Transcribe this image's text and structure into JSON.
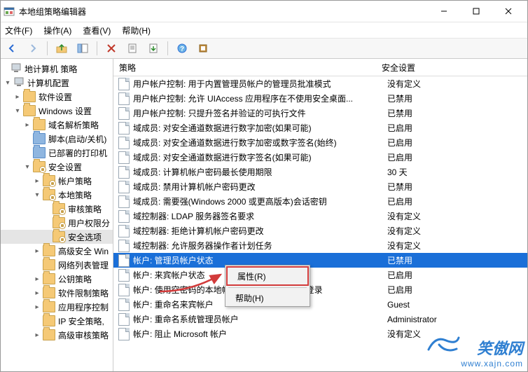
{
  "window": {
    "title": "本地组策略编辑器"
  },
  "menu": {
    "file": "文件(F)",
    "action": "操作(A)",
    "view": "查看(V)",
    "help": "帮助(H)"
  },
  "columns": {
    "policy": "策略",
    "setting": "安全设置"
  },
  "tree": {
    "root": "地计算机 策略",
    "computer_config": "计算机配置",
    "software_settings": "软件设置",
    "windows_settings": "Windows 设置",
    "name_resolution": "域名解析策略",
    "scripts": "脚本(启动/关机)",
    "deployed_printers": "已部署的打印机",
    "security_settings": "安全设置",
    "account_policies": "帐户策略",
    "local_policies": "本地策略",
    "audit_policy": "审核策略",
    "user_rights": "用户权限分",
    "security_options": "安全选项",
    "adv_win": "高级安全 Win",
    "network_list": "网络列表管理",
    "pubkey_policies": "公钥策略",
    "software_restrict": "软件限制策略",
    "app_control": "应用程序控制",
    "ip_sec": "IP 安全策略,",
    "adv_audit": "高级审核策略"
  },
  "policies": [
    {
      "name": "用户帐户控制: 用于内置管理员帐户的管理员批准模式",
      "setting": "没有定义"
    },
    {
      "name": "用户帐户控制: 允许 UIAccess 应用程序在不使用安全桌面...",
      "setting": "已禁用"
    },
    {
      "name": "用户帐户控制: 只提升签名并验证的可执行文件",
      "setting": "已禁用"
    },
    {
      "name": "域成员: 对安全通道数据进行数字加密(如果可能)",
      "setting": "已启用"
    },
    {
      "name": "域成员: 对安全通道数据进行数字加密或数字签名(始终)",
      "setting": "已启用"
    },
    {
      "name": "域成员: 对安全通道数据进行数字签名(如果可能)",
      "setting": "已启用"
    },
    {
      "name": "域成员: 计算机帐户密码最长使用期限",
      "setting": "30 天"
    },
    {
      "name": "域成员: 禁用计算机帐户密码更改",
      "setting": "已禁用"
    },
    {
      "name": "域成员: 需要强(Windows 2000 或更高版本)会话密钥",
      "setting": "已启用"
    },
    {
      "name": "域控制器: LDAP 服务器签名要求",
      "setting": "没有定义"
    },
    {
      "name": "域控制器: 拒绝计算机帐户密码更改",
      "setting": "没有定义"
    },
    {
      "name": "域控制器: 允许服务器操作者计划任务",
      "setting": "没有定义"
    },
    {
      "name": "帐户: 管理员帐户状态",
      "setting": "已禁用",
      "selected": true
    },
    {
      "name": "帐户: 来宾帐户状态",
      "setting": "已启用"
    },
    {
      "name": "帐户: 使用空密码的本地帐户只允许进行控制台登录",
      "setting": "已启用"
    },
    {
      "name": "帐户: 重命名来宾帐户",
      "setting": "Guest"
    },
    {
      "name": "帐户: 重命名系统管理员帐户",
      "setting": "Administrator"
    },
    {
      "name": "帐户: 阻止 Microsoft 帐户",
      "setting": "没有定义"
    }
  ],
  "context_menu": {
    "properties": "属性(R)",
    "help": "帮助(H)"
  },
  "watermark": {
    "brand": "笑傲网",
    "url": "www.xajn.com"
  }
}
